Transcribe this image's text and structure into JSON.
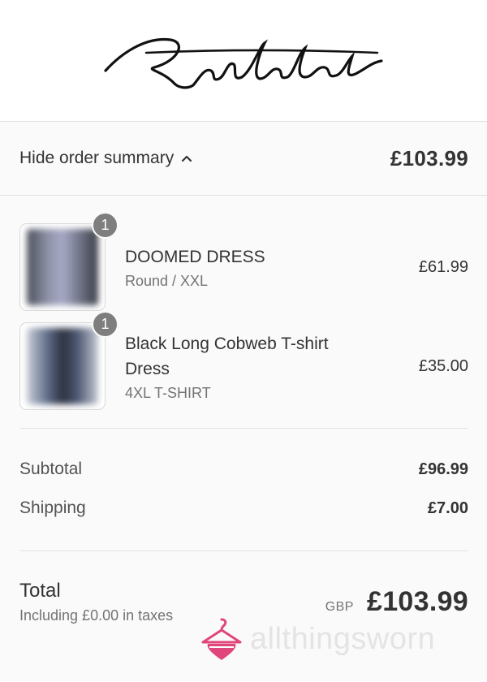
{
  "brand": {
    "logo_text": "Ratchet"
  },
  "summary_bar": {
    "toggle_label": "Hide order summary",
    "toggle_icon": "chevron-up-icon",
    "total": "£103.99"
  },
  "items": [
    {
      "quantity": "1",
      "name": "DOOMED DRESS",
      "variant": "Round / XXL",
      "price": "£61.99"
    },
    {
      "quantity": "1",
      "name": "Black Long Cobweb T-shirt Dress",
      "variant": "4XL T-SHIRT",
      "price": "£35.00"
    }
  ],
  "costs": {
    "subtotal_label": "Subtotal",
    "subtotal_value": "£96.99",
    "shipping_label": "Shipping",
    "shipping_value": "£7.00"
  },
  "total": {
    "label": "Total",
    "tax_note": "Including £0.00 in taxes",
    "currency": "GBP",
    "amount": "£103.99"
  },
  "watermark": {
    "text": "allthingsworn",
    "color": "#e0457b"
  }
}
